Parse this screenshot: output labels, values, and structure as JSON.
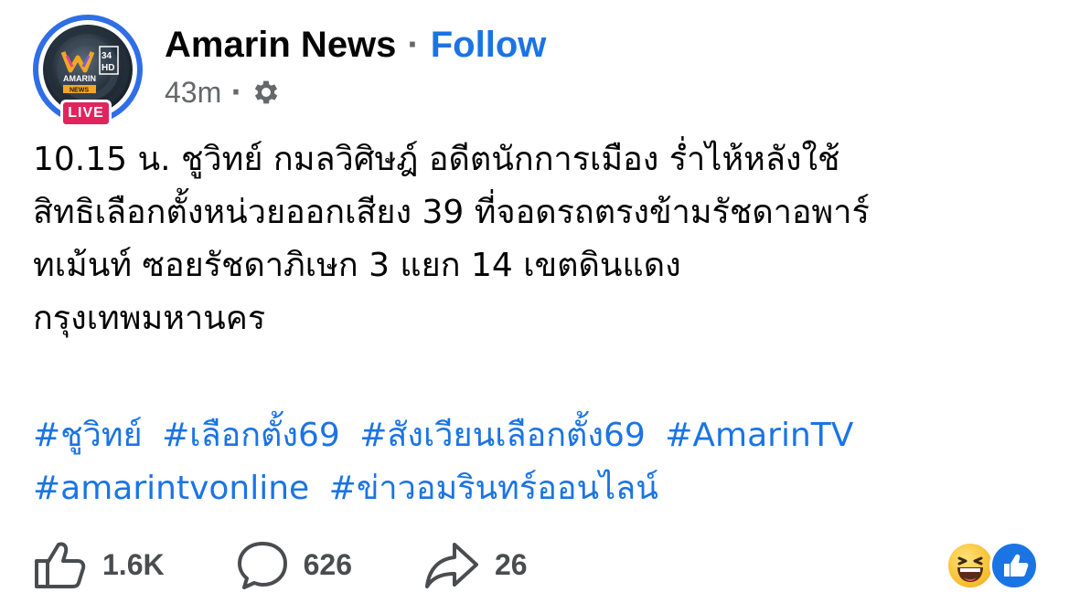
{
  "post": {
    "page_name": "Amarin News",
    "separator": "·",
    "follow_label": "Follow",
    "timestamp": "43m",
    "meta_separator": "·",
    "audience_icon": "gear-icon",
    "live_badge": "LIVE",
    "avatar_logo": {
      "text": "AMARIN",
      "sub": "NEWS",
      "channel": "34",
      "channel_sub": "HD"
    },
    "text_lines": [
      "10.15 น. ชูวิทย์ กมลวิศิษฎ์ อดีตนักการเมือง ร่ำไห้หลังใช้",
      "สิทธิเลือกตั้งหน่วยออกเสียง 39 ที่จอดรถตรงข้ามรัชดาอพาร์",
      "ทเม้นท์ ซอยรัชดาภิเษก 3 แยก 14 เขตดินแดง",
      "กรุงเทพมหานคร"
    ],
    "hashtags_row1": [
      "#ชูวิทย์",
      "#เลือกตั้ง69",
      "#สังเวียนเลือกตั้ง69",
      "#AmarinTV"
    ],
    "hashtags_row2": [
      "#amarintvonline",
      "#ข่าวอมรินทร์ออนไลน์"
    ]
  },
  "actions": {
    "like_count": "1.6K",
    "comment_count": "626",
    "share_count": "26",
    "like_icon": "thumbs-up-icon",
    "comment_icon": "comment-bubble-icon",
    "share_icon": "share-arrow-icon"
  },
  "reactions": [
    "haha",
    "like"
  ],
  "colors": {
    "accent": "#1b74e4",
    "live": "#e0245e",
    "ring": "#2f6ee6",
    "muted": "#65676b"
  }
}
